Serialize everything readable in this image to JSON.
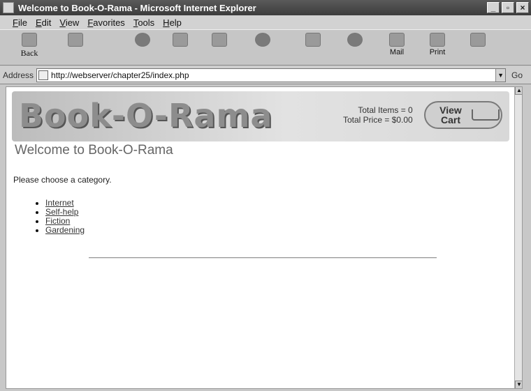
{
  "window": {
    "title": "Welcome to Book-O-Rama - Microsoft Internet Explorer"
  },
  "menu": [
    "File",
    "Edit",
    "View",
    "Favorites",
    "Tools",
    "Help"
  ],
  "toolbar": {
    "back_label": "Back",
    "mail_label": "Mail",
    "print_label": "Print"
  },
  "address": {
    "label": "Address",
    "url": "http://webserver/chapter25/index.php",
    "go_label": "Go"
  },
  "page": {
    "logo": "Book-O-Rama",
    "total_items": "Total Items = 0",
    "total_price": "Total Price = $0.00",
    "view_cart": "View Cart",
    "heading": "Welcome to Book-O-Rama",
    "prompt": "Please choose a category.",
    "categories": [
      "Internet",
      "Self-help",
      "Fiction",
      "Gardening"
    ]
  }
}
